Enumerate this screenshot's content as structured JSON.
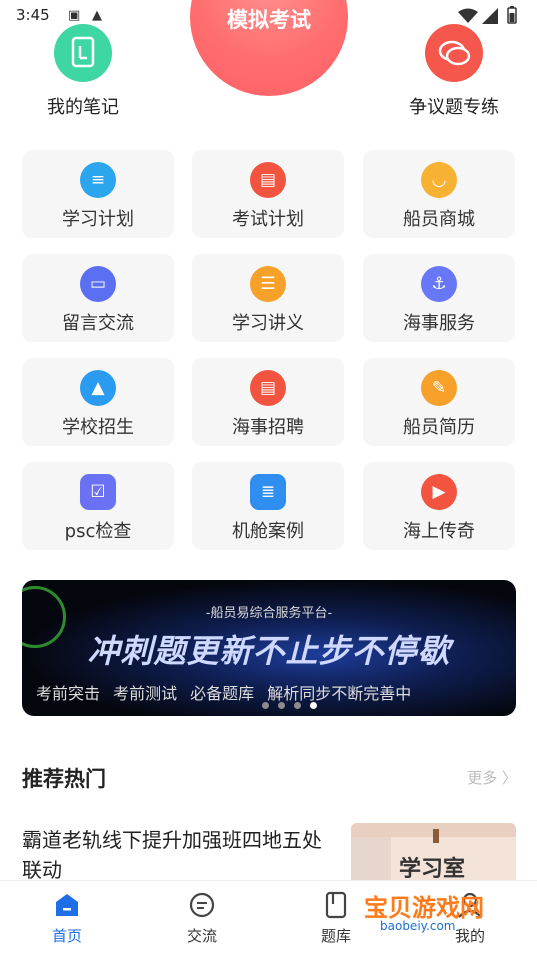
{
  "status_bar": {
    "time": "3:45"
  },
  "exam_button": {
    "label": "模拟考试"
  },
  "top_items": [
    {
      "label": "我的笔记",
      "icon": "note-icon",
      "color": "#3ed6a3"
    },
    {
      "label": "争议题专练",
      "icon": "chat-bubbles-icon",
      "color": "#f5574c"
    }
  ],
  "grid": [
    {
      "label": "学习计划",
      "icon": "study-plan-icon",
      "color": "#2aa5ee"
    },
    {
      "label": "考试计划",
      "icon": "exam-plan-icon",
      "color": "#f2543f"
    },
    {
      "label": "船员商城",
      "icon": "shop-icon",
      "color": "#f8b233"
    },
    {
      "label": "留言交流",
      "icon": "message-icon",
      "color": "#5b6ff2"
    },
    {
      "label": "学习讲义",
      "icon": "lecture-icon",
      "color": "#f8a12a"
    },
    {
      "label": "海事服务",
      "icon": "anchor-icon",
      "color": "#6877f5"
    },
    {
      "label": "学校招生",
      "icon": "sailboat-icon",
      "color": "#2a9bee"
    },
    {
      "label": "海事招聘",
      "icon": "recruit-icon",
      "color": "#f2543f"
    },
    {
      "label": "船员简历",
      "icon": "resume-icon",
      "color": "#f8a12a"
    },
    {
      "label": "psc检查",
      "icon": "checklist-icon",
      "color": "#6a72f3"
    },
    {
      "label": "机舱案例",
      "icon": "document-icon",
      "color": "#2f8ff0"
    },
    {
      "label": "海上传奇",
      "icon": "video-icon",
      "color": "#f2543f"
    }
  ],
  "banner": {
    "subtitle": "-船员易综合服务平台-",
    "headline": "冲刺题更新不止步不停歇",
    "tags": "考前突击 考前测试 必备题库 解析同步不断完善中",
    "slide_count": 4,
    "active_slide": 4
  },
  "section": {
    "title": "推荐热门",
    "more_label": "更多 〉"
  },
  "article": {
    "title": "霸道老轨线下提升加强班四地五处联动",
    "thumb_text": "学习室"
  },
  "nav": [
    {
      "label": "首页",
      "icon": "home-icon",
      "active": true
    },
    {
      "label": "交流",
      "icon": "chat-icon",
      "active": false
    },
    {
      "label": "题库",
      "icon": "question-bank-icon",
      "active": false
    },
    {
      "label": "我的",
      "icon": "profile-icon",
      "active": false
    }
  ],
  "watermark": {
    "text": "宝贝游戏网",
    "url": "baobeiy.com"
  },
  "colors": {
    "accent": "#1e6fe6",
    "exam_pink": "#ff6e6e"
  }
}
